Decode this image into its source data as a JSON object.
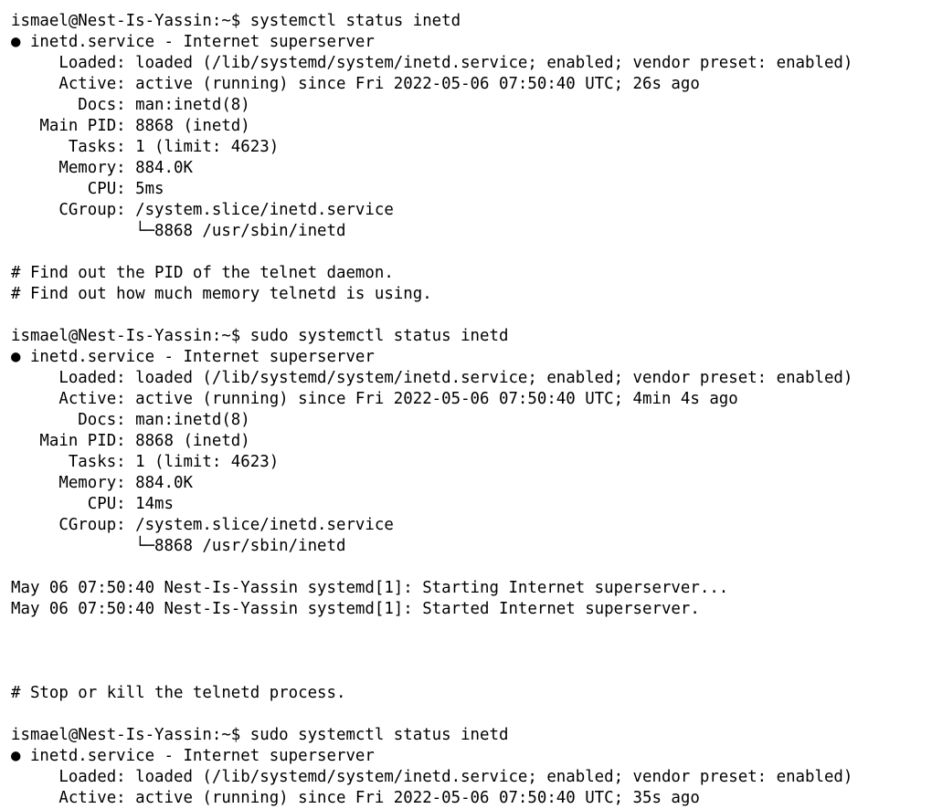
{
  "terminal": {
    "lines": [
      "ismael@Nest-Is-Yassin:~$ systemctl status inetd",
      "● inetd.service - Internet superserver",
      "     Loaded: loaded (/lib/systemd/system/inetd.service; enabled; vendor preset: enabled)",
      "     Active: active (running) since Fri 2022-05-06 07:50:40 UTC; 26s ago",
      "       Docs: man:inetd(8)",
      "   Main PID: 8868 (inetd)",
      "      Tasks: 1 (limit: 4623)",
      "     Memory: 884.0K",
      "        CPU: 5ms",
      "     CGroup: /system.slice/inetd.service",
      "             └─8868 /usr/sbin/inetd",
      "",
      "# Find out the PID of the telnet daemon.",
      "# Find out how much memory telnetd is using.",
      "",
      "ismael@Nest-Is-Yassin:~$ sudo systemctl status inetd",
      "● inetd.service - Internet superserver",
      "     Loaded: loaded (/lib/systemd/system/inetd.service; enabled; vendor preset: enabled)",
      "     Active: active (running) since Fri 2022-05-06 07:50:40 UTC; 4min 4s ago",
      "       Docs: man:inetd(8)",
      "   Main PID: 8868 (inetd)",
      "      Tasks: 1 (limit: 4623)",
      "     Memory: 884.0K",
      "        CPU: 14ms",
      "     CGroup: /system.slice/inetd.service",
      "             └─8868 /usr/sbin/inetd",
      "",
      "May 06 07:50:40 Nest-Is-Yassin systemd[1]: Starting Internet superserver...",
      "May 06 07:50:40 Nest-Is-Yassin systemd[1]: Started Internet superserver.",
      "",
      "",
      "",
      "# Stop or kill the telnetd process.",
      "",
      "ismael@Nest-Is-Yassin:~$ sudo systemctl status inetd",
      "● inetd.service - Internet superserver",
      "     Loaded: loaded (/lib/systemd/system/inetd.service; enabled; vendor preset: enabled)",
      "     Active: active (running) since Fri 2022-05-06 07:50:40 UTC; 35s ago"
    ]
  },
  "colors": {
    "background": "#ffffff",
    "text": "#000000"
  }
}
